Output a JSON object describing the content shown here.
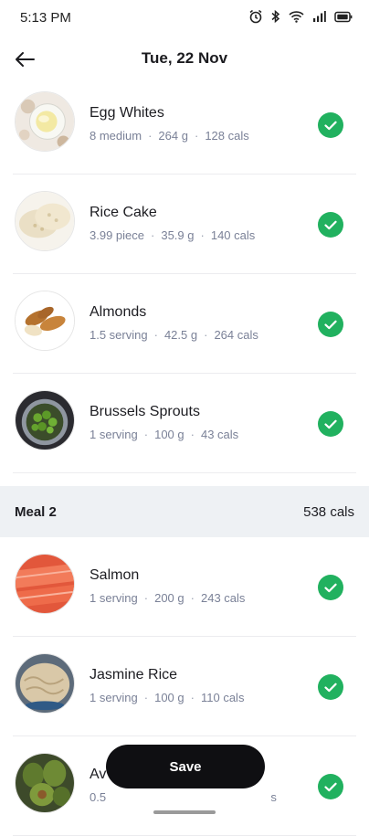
{
  "status_bar": {
    "time": "5:13 PM",
    "icons": [
      "alarm-icon",
      "bluetooth-icon",
      "wifi-icon",
      "signal-icon",
      "battery-icon"
    ]
  },
  "header": {
    "title": "Tue, 22 Nov",
    "back_icon": "arrow-left-icon"
  },
  "meal1": {
    "items": [
      {
        "name": "Egg Whites",
        "amount": "8 medium",
        "weight": "264 g",
        "cals": "128 cals",
        "logged": true
      },
      {
        "name": "Rice Cake",
        "amount": "3.99 piece",
        "weight": "35.9 g",
        "cals": "140 cals",
        "logged": true
      },
      {
        "name": "Almonds",
        "amount": "1.5 serving",
        "weight": "42.5 g",
        "cals": "264 cals",
        "logged": true
      },
      {
        "name": "Brussels Sprouts",
        "amount": "1 serving",
        "weight": "100 g",
        "cals": "43 cals",
        "logged": true
      }
    ]
  },
  "meal2": {
    "title": "Meal 2",
    "total": "538 cals",
    "items": [
      {
        "name": "Salmon",
        "amount": "1 serving",
        "weight": "200 g",
        "cals": "243 cals",
        "logged": true
      },
      {
        "name": "Jasmine Rice",
        "amount": "1 serving",
        "weight": "100 g",
        "cals": "110 cals",
        "logged": true
      },
      {
        "name": "Av",
        "amount": "0.5",
        "weight": "",
        "cals": "s",
        "logged": true
      }
    ]
  },
  "save_button": {
    "label": "Save"
  },
  "colors": {
    "accent_green": "#21b15f",
    "meal_header_bg": "#eef1f4",
    "button_bg": "#0f0f12",
    "meta_text": "#7a8197"
  }
}
